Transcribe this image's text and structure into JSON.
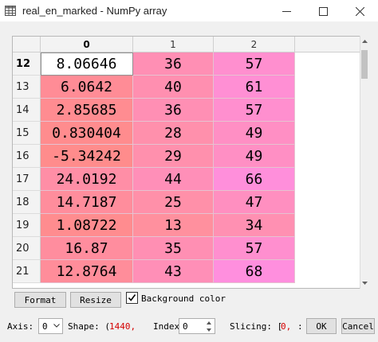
{
  "window": {
    "title": "real_en_marked - NumPy array",
    "app_icon": "table-grid-icon",
    "controls": [
      "minimize-icon",
      "maximize-icon",
      "close-icon"
    ]
  },
  "table": {
    "column_headers": [
      "0",
      "1",
      "2"
    ],
    "active_column": "0",
    "active_row": "12",
    "rows": [
      {
        "index": "12",
        "cells": [
          "8.06646",
          "36",
          "57"
        ],
        "colors": [
          "#ffffff",
          "#ff8fb4",
          "#ff8fcf"
        ]
      },
      {
        "index": "13",
        "cells": [
          "6.0642",
          "40",
          "61"
        ],
        "colors": [
          "#ff8c96",
          "#ff8fb0",
          "#ff8fd4"
        ]
      },
      {
        "index": "14",
        "cells": [
          "2.85685",
          "36",
          "57"
        ],
        "colors": [
          "#ff8c91",
          "#ff8fb4",
          "#ff8fcf"
        ]
      },
      {
        "index": "15",
        "cells": [
          "0.830404",
          "28",
          "49"
        ],
        "colors": [
          "#ff8c8e",
          "#ff90ac",
          "#ff8fc4"
        ]
      },
      {
        "index": "16",
        "cells": [
          "-5.34242",
          "29",
          "49"
        ],
        "colors": [
          "#ff8c8c",
          "#ff90ad",
          "#ff8fc4"
        ]
      },
      {
        "index": "17",
        "cells": [
          "24.0192",
          "44",
          "66"
        ],
        "colors": [
          "#ff8ea6",
          "#ff8fb8",
          "#ff8fdb"
        ]
      },
      {
        "index": "18",
        "cells": [
          "14.7187",
          "25",
          "47"
        ],
        "colors": [
          "#ff8d9c",
          "#ff90a9",
          "#ff8fc0"
        ]
      },
      {
        "index": "19",
        "cells": [
          "1.08722",
          "13",
          "34"
        ],
        "colors": [
          "#ff8c8f",
          "#ff909e",
          "#ff90b2"
        ]
      },
      {
        "index": "20",
        "cells": [
          "16.87",
          "35",
          "57"
        ],
        "colors": [
          "#ff8d9e",
          "#ff8fb3",
          "#ff8fcf"
        ]
      },
      {
        "index": "21",
        "cells": [
          "12.8764",
          "43",
          "68"
        ],
        "colors": [
          "#ff8d9a",
          "#ff8fb7",
          "#ff8fde"
        ]
      }
    ]
  },
  "controls": {
    "format_label": "Format",
    "resize_label": "Resize",
    "background_color_label": "Background color",
    "background_color_checked": true,
    "axis_label": "Axis:",
    "axis_value": "0",
    "shape_label": "Shape: (",
    "shape_value": "1440,",
    "index_label": "Index:",
    "index_value": "0",
    "slicing_label": "Slicing: [",
    "slicing_value": "0,",
    "slicing_tail": ":",
    "ok_label": "OK",
    "cancel_label": "Cancel"
  }
}
